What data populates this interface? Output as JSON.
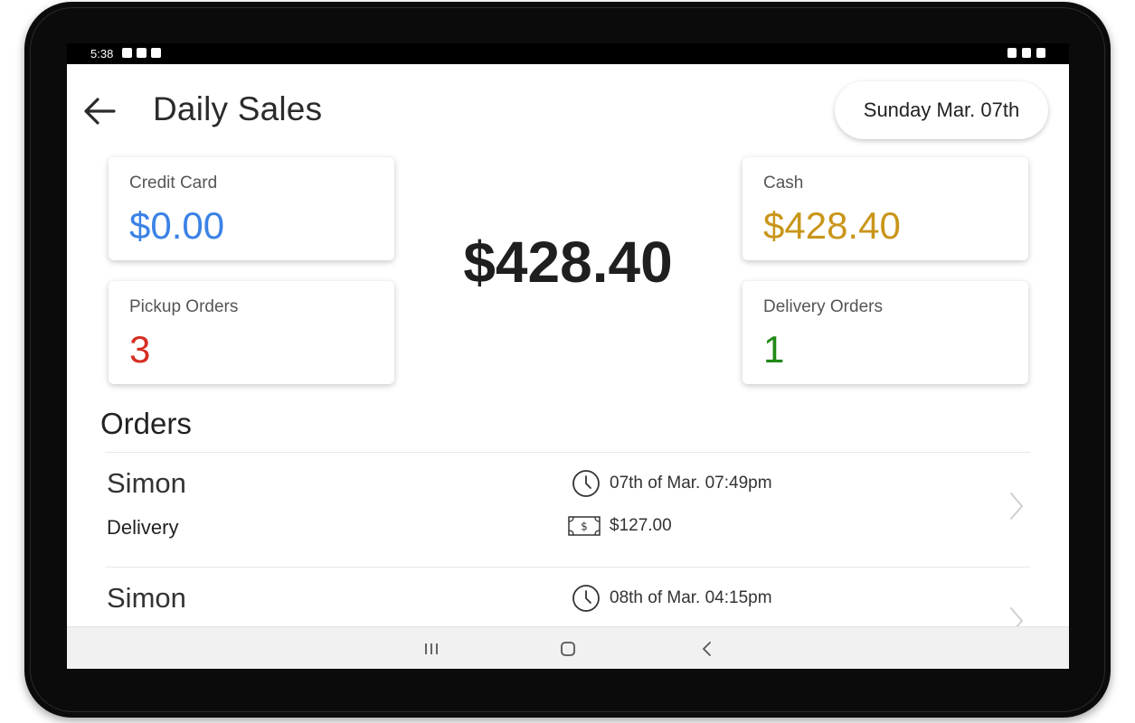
{
  "status_bar": {
    "time": "5:38"
  },
  "header": {
    "title": "Daily Sales",
    "date": "Sunday Mar. 07th"
  },
  "summary": {
    "total": "$428.40",
    "credit_card": {
      "label": "Credit Card",
      "value": "$0.00"
    },
    "cash": {
      "label": "Cash",
      "value": "$428.40"
    },
    "pickup": {
      "label": "Pickup Orders",
      "value": "3"
    },
    "delivery": {
      "label": "Delivery Orders",
      "value": "1"
    }
  },
  "colors": {
    "credit_card": "#3b82e6",
    "cash": "#c9961a",
    "pickup": "#d62e22",
    "delivery": "#1f8a16"
  },
  "orders": {
    "title": "Orders",
    "items": [
      {
        "name": "Simon",
        "type": "Delivery",
        "time": "07th of Mar. 07:49pm",
        "amount": "$127.00"
      },
      {
        "name": "Simon",
        "type": "",
        "time": "08th of Mar. 04:15pm",
        "amount": ""
      }
    ]
  },
  "icons": {
    "back": "arrow-left-icon",
    "clock": "clock-icon",
    "money": "cash-bill-icon",
    "chevron": "chevron-right-icon"
  }
}
